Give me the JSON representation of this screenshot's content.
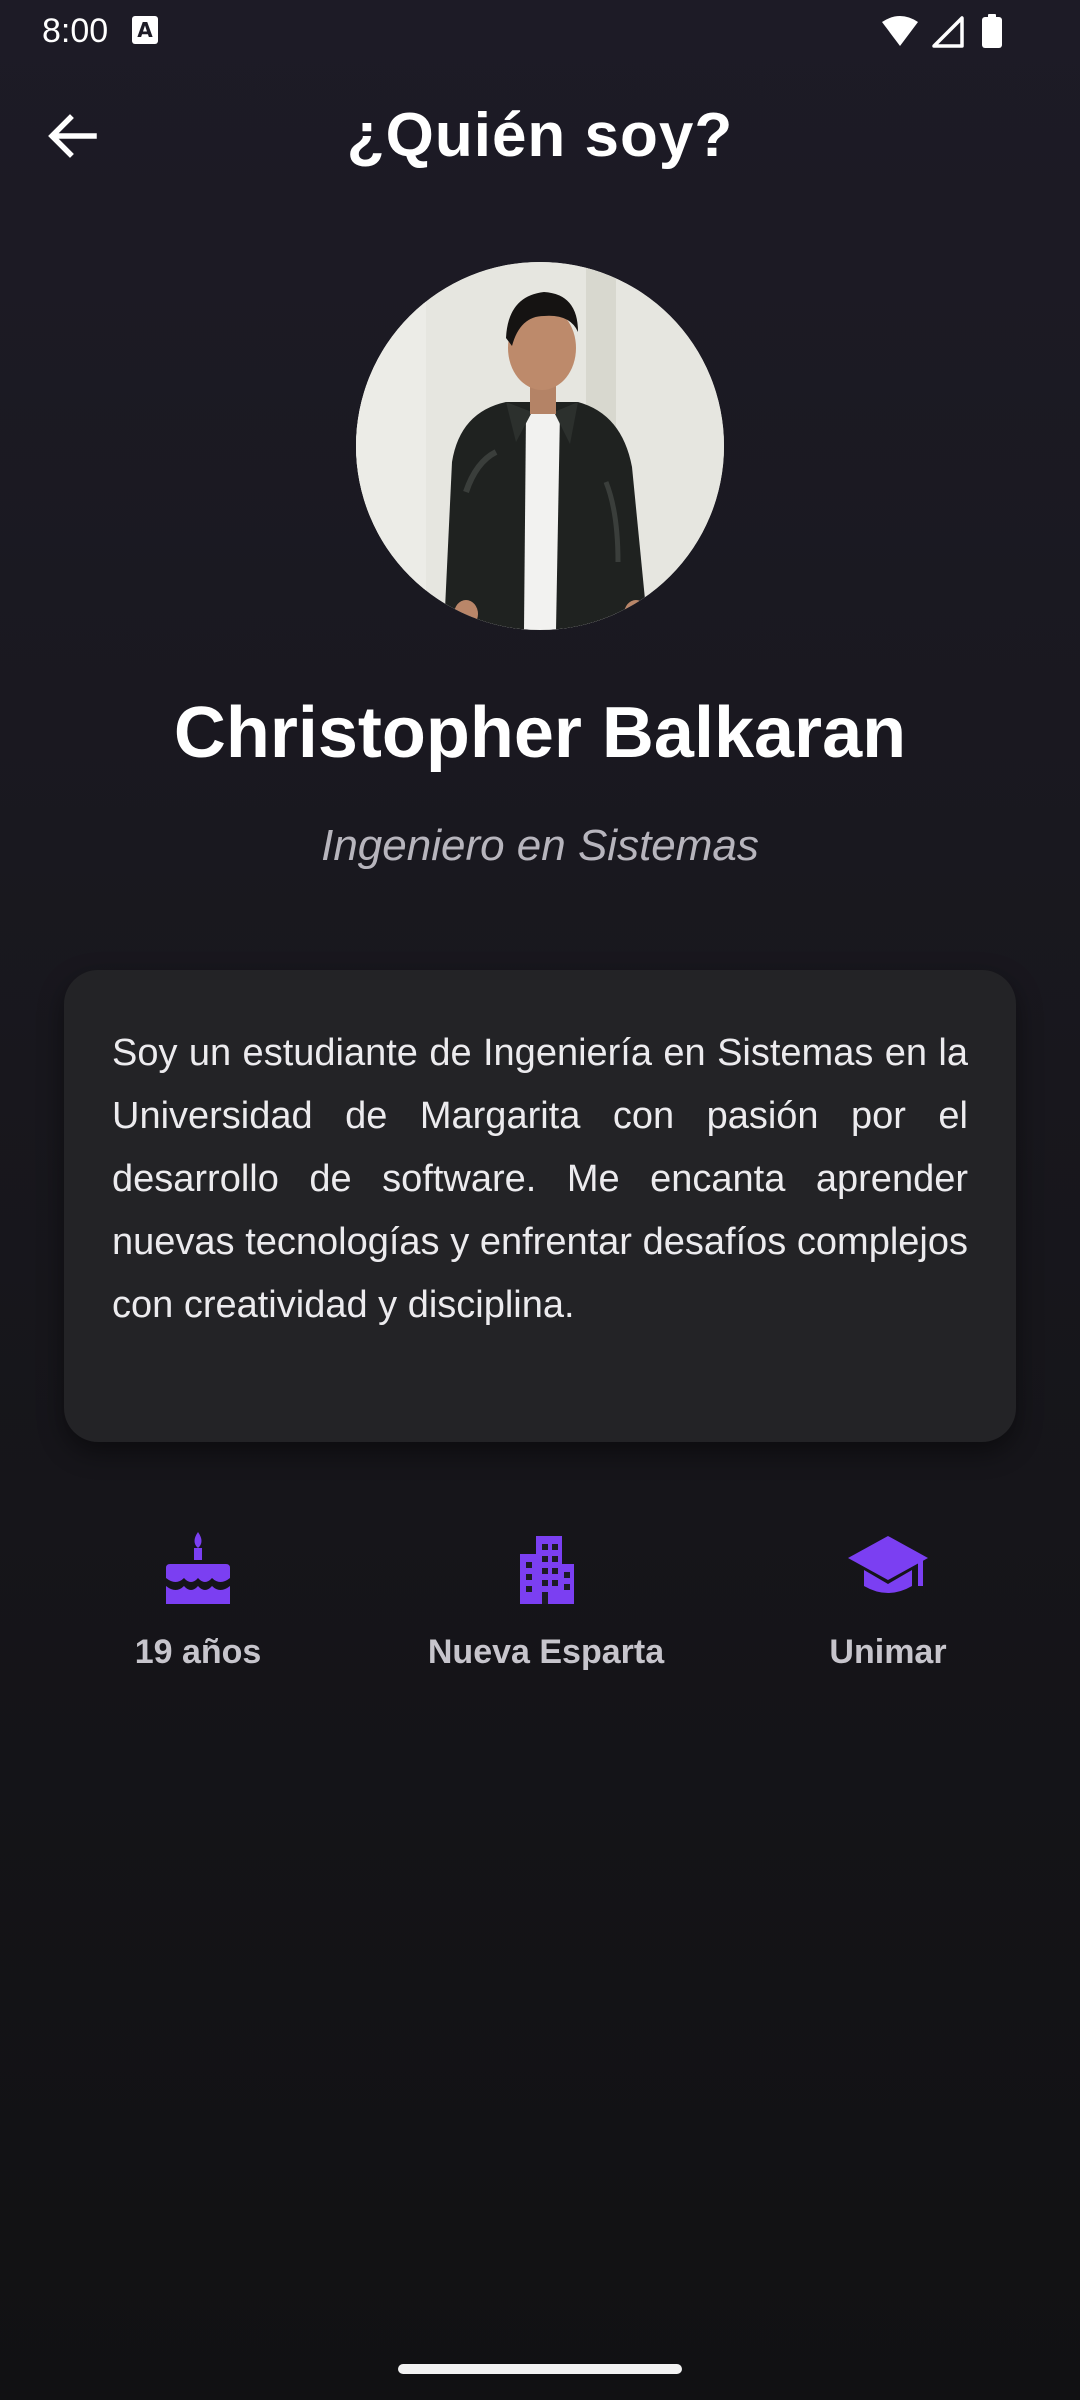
{
  "status_bar": {
    "time": "8:00",
    "notification_icon": "a-notification-icon",
    "icons": [
      "wifi-icon",
      "signal-icon",
      "battery-icon"
    ]
  },
  "app_bar": {
    "back_icon": "arrow-left-icon",
    "title": "¿Quién soy?"
  },
  "profile": {
    "name": "Christopher Balkaran",
    "role": "Ingeniero en Sistemas",
    "bio": "Soy un estudiante de Ingeniería en Sistemas en la Universidad de Margarita con pasión por el desarrollo de software. Me encanta aprender nuevas tecnologías y enfrentar desafíos complejos con creatividad y disciplina."
  },
  "info": [
    {
      "icon": "cake-icon",
      "label": "19 años"
    },
    {
      "icon": "city-icon",
      "label": "Nueva Esparta"
    },
    {
      "icon": "graduation-cap-icon",
      "label": "Unimar"
    }
  ],
  "colors": {
    "accent": "#7b3ff2",
    "background": "#1d1b26",
    "card": "#232326"
  }
}
